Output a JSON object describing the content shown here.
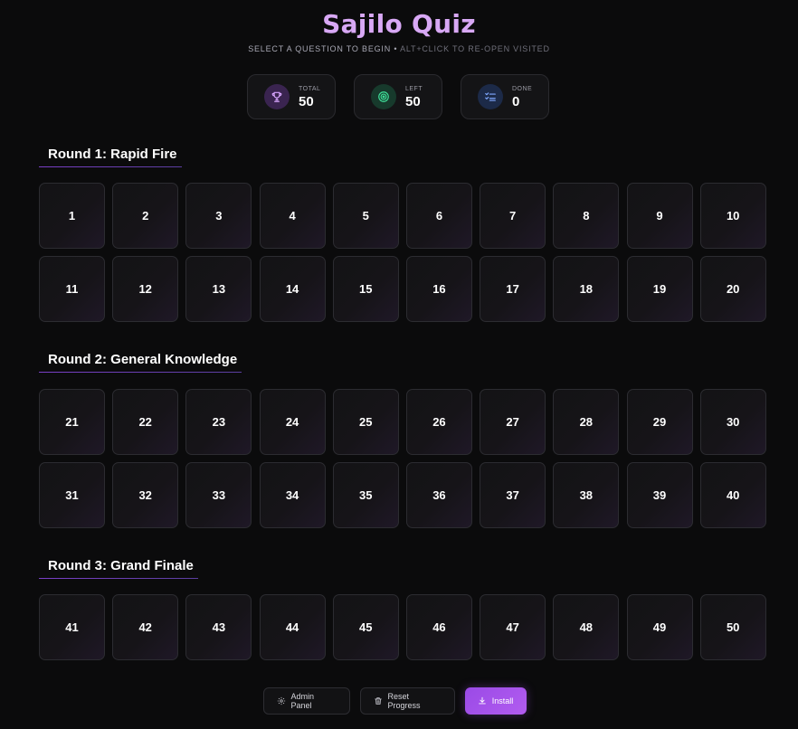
{
  "app": {
    "title": "Sajilo Quiz",
    "subtitle_main": "SELECT A QUESTION TO BEGIN",
    "subtitle_sep": " • ",
    "subtitle_hint": "ALT+CLICK TO RE-OPEN VISITED"
  },
  "stats": [
    {
      "label": "TOTAL",
      "value": "50",
      "icon": "trophy-icon"
    },
    {
      "label": "LEFT",
      "value": "50",
      "icon": "target-icon"
    },
    {
      "label": "DONE",
      "value": "0",
      "icon": "checklist-icon"
    }
  ],
  "rounds": [
    {
      "title": "Round 1: Rapid Fire",
      "questions": [
        "1",
        "2",
        "3",
        "4",
        "5",
        "6",
        "7",
        "8",
        "9",
        "10",
        "11",
        "12",
        "13",
        "14",
        "15",
        "16",
        "17",
        "18",
        "19",
        "20"
      ]
    },
    {
      "title": "Round 2: General Knowledge",
      "questions": [
        "21",
        "22",
        "23",
        "24",
        "25",
        "26",
        "27",
        "28",
        "29",
        "30",
        "31",
        "32",
        "33",
        "34",
        "35",
        "36",
        "37",
        "38",
        "39",
        "40"
      ]
    },
    {
      "title": "Round 3: Grand Finale",
      "questions": [
        "41",
        "42",
        "43",
        "44",
        "45",
        "46",
        "47",
        "48",
        "49",
        "50"
      ]
    }
  ],
  "actions": {
    "admin_label": "Admin Panel",
    "reset_label": "Reset Progress",
    "install_label": "Install"
  },
  "colors": {
    "accent": "#a855f7",
    "title": "#d8a8f5",
    "background": "#0b0b0c"
  }
}
